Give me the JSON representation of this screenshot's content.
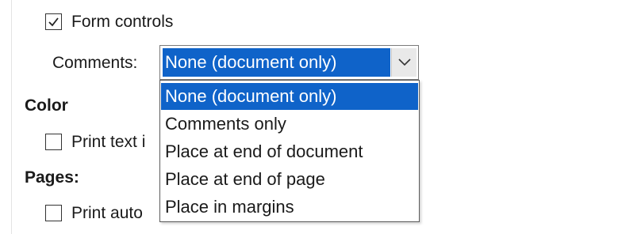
{
  "form_controls": {
    "label": "Form controls",
    "checked": true
  },
  "comments": {
    "label": "Comments:",
    "selected": "None (document only)",
    "options": [
      "None (document only)",
      "Comments only",
      "Place at end of document",
      "Place at end of page",
      "Place in margins"
    ]
  },
  "color_section": {
    "heading": "Color",
    "checkbox_label": "Print text i"
  },
  "pages_section": {
    "heading": "Pages:",
    "checkbox_label": "Print auto"
  },
  "colors": {
    "selection": "#0f63c9"
  },
  "icons": {
    "check": "checkmark-icon",
    "dropdown": "chevron-down-icon"
  }
}
